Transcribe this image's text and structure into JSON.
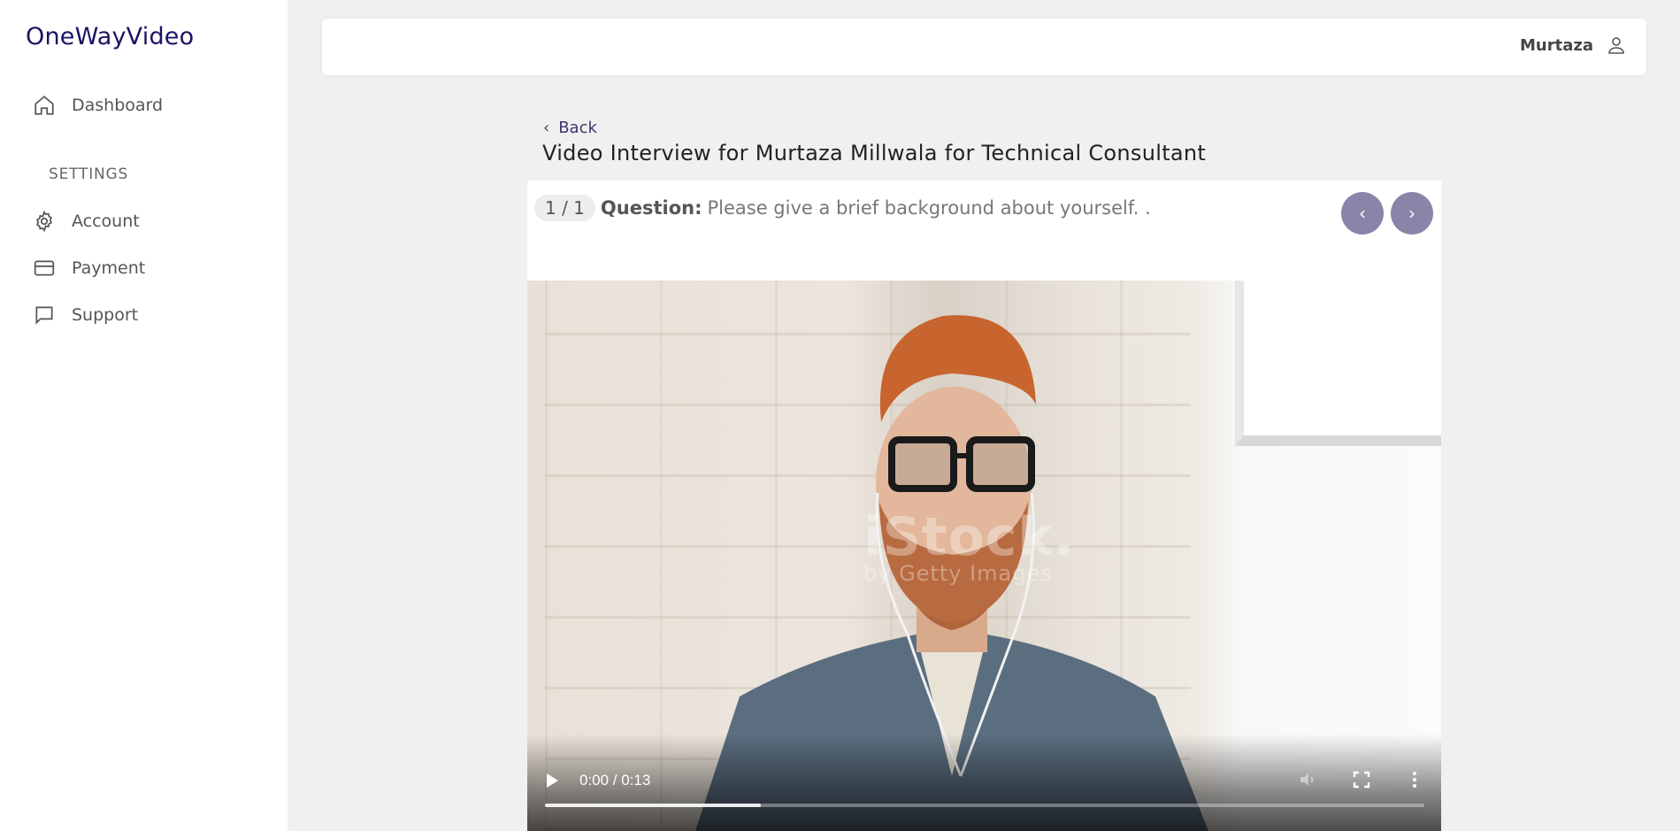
{
  "app": {
    "brand": "OneWayVideo"
  },
  "sidebar": {
    "items": [
      {
        "label": "Dashboard",
        "icon": "home-icon"
      }
    ],
    "settings_heading": "SETTINGS",
    "settings_items": [
      {
        "label": "Account",
        "icon": "gear-icon"
      },
      {
        "label": "Payment",
        "icon": "credit-card-icon"
      },
      {
        "label": "Support",
        "icon": "chat-bubble-icon"
      }
    ]
  },
  "header": {
    "user_name": "Murtaza",
    "user_icon": "user-icon"
  },
  "page": {
    "back_label": "Back",
    "title": "Video Interview for Murtaza Millwala for Technical Consultant"
  },
  "question": {
    "counter": "1 / 1",
    "label": "Question:",
    "text": "Please give a brief background about yourself. .",
    "prev_icon": "chevron-left-icon",
    "next_icon": "chevron-right-icon"
  },
  "video": {
    "time": "0:00 / 0:13",
    "buffered_fraction": 0.245,
    "watermark": "iStock.",
    "watermark_sub": "by Getty Images"
  },
  "colors": {
    "brand": "#1b1464",
    "accent": "#8b83a8",
    "background": "#f0f0f0"
  }
}
